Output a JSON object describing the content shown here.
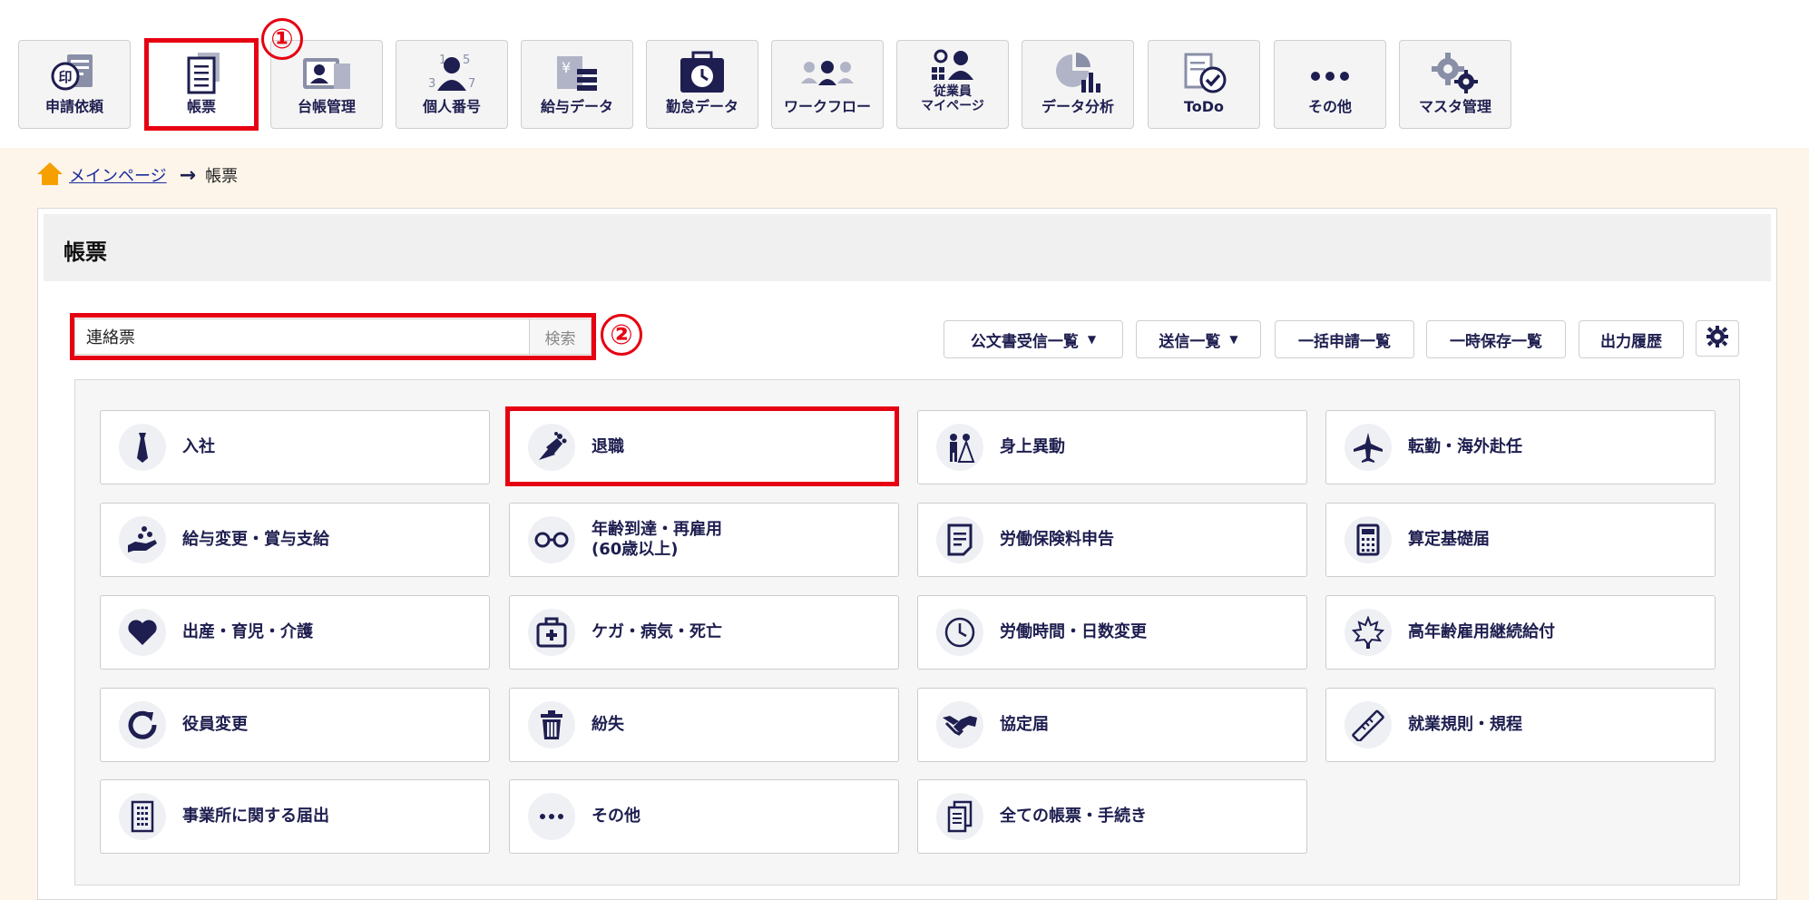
{
  "nav": {
    "items": [
      {
        "label": "申請依頼",
        "icon": "stamp-document-icon"
      },
      {
        "label": "帳票",
        "icon": "document-stack-icon"
      },
      {
        "label": "台帳管理",
        "icon": "id-card-icon"
      },
      {
        "label": "個人番号",
        "icon": "person-number-icon"
      },
      {
        "label": "給与データ",
        "icon": "salary-data-icon"
      },
      {
        "label": "勤怠データ",
        "icon": "attendance-clock-icon"
      },
      {
        "label": "ワークフロー",
        "icon": "workflow-people-icon"
      },
      {
        "label": "従業員\nマイページ",
        "icon": "employee-mypage-icon"
      },
      {
        "label": "データ分析",
        "icon": "data-analysis-icon"
      },
      {
        "label": "ToDo",
        "icon": "todo-check-icon"
      },
      {
        "label": "その他",
        "icon": "more-dots-icon"
      },
      {
        "label": "マスタ管理",
        "icon": "gears-icon"
      }
    ]
  },
  "annotations": {
    "one": "①",
    "two": "②"
  },
  "breadcrumb": {
    "home": "メインページ",
    "current": "帳票"
  },
  "panel": {
    "title": "帳票"
  },
  "search": {
    "value": "連絡票",
    "button": "検索"
  },
  "toolbar": {
    "public_docs": "公文書受信一覧",
    "sent": "送信一覧",
    "bulk": "一括申請一覧",
    "temp": "一時保存一覧",
    "history": "出力履歴"
  },
  "cards": [
    {
      "label": "入社",
      "icon": "necktie-icon"
    },
    {
      "label": "退職",
      "icon": "bouquet-icon"
    },
    {
      "label": "身上異動",
      "icon": "wedding-couple-icon"
    },
    {
      "label": "転勤・海外赴任",
      "icon": "airplane-icon"
    },
    {
      "label": "給与変更・賞与支給",
      "icon": "hand-coins-icon"
    },
    {
      "label": "年齢到達・再雇用\n(60歳以上)",
      "icon": "glasses-icon"
    },
    {
      "label": "労働保険料申告",
      "icon": "document-lines-icon"
    },
    {
      "label": "算定基礎届",
      "icon": "calculator-icon"
    },
    {
      "label": "出産・育児・介護",
      "icon": "heart-icon"
    },
    {
      "label": "ケガ・病気・死亡",
      "icon": "first-aid-kit-icon"
    },
    {
      "label": "労働時間・日数変更",
      "icon": "clock-icon"
    },
    {
      "label": "高年齢雇用継続給付",
      "icon": "maple-leaf-icon"
    },
    {
      "label": "役員変更",
      "icon": "refresh-icon"
    },
    {
      "label": "紛失",
      "icon": "trash-icon"
    },
    {
      "label": "協定届",
      "icon": "handshake-icon"
    },
    {
      "label": "就業規則・規程",
      "icon": "ruler-icon"
    },
    {
      "label": "事業所に関する届出",
      "icon": "building-icon"
    },
    {
      "label": "その他",
      "icon": "ellipsis-icon"
    },
    {
      "label": "全ての帳票・手続き",
      "icon": "documents-icon"
    }
  ],
  "colors": {
    "navy": "#1e1e50",
    "highlight": "#e60012",
    "background": "#fdf5ea"
  }
}
